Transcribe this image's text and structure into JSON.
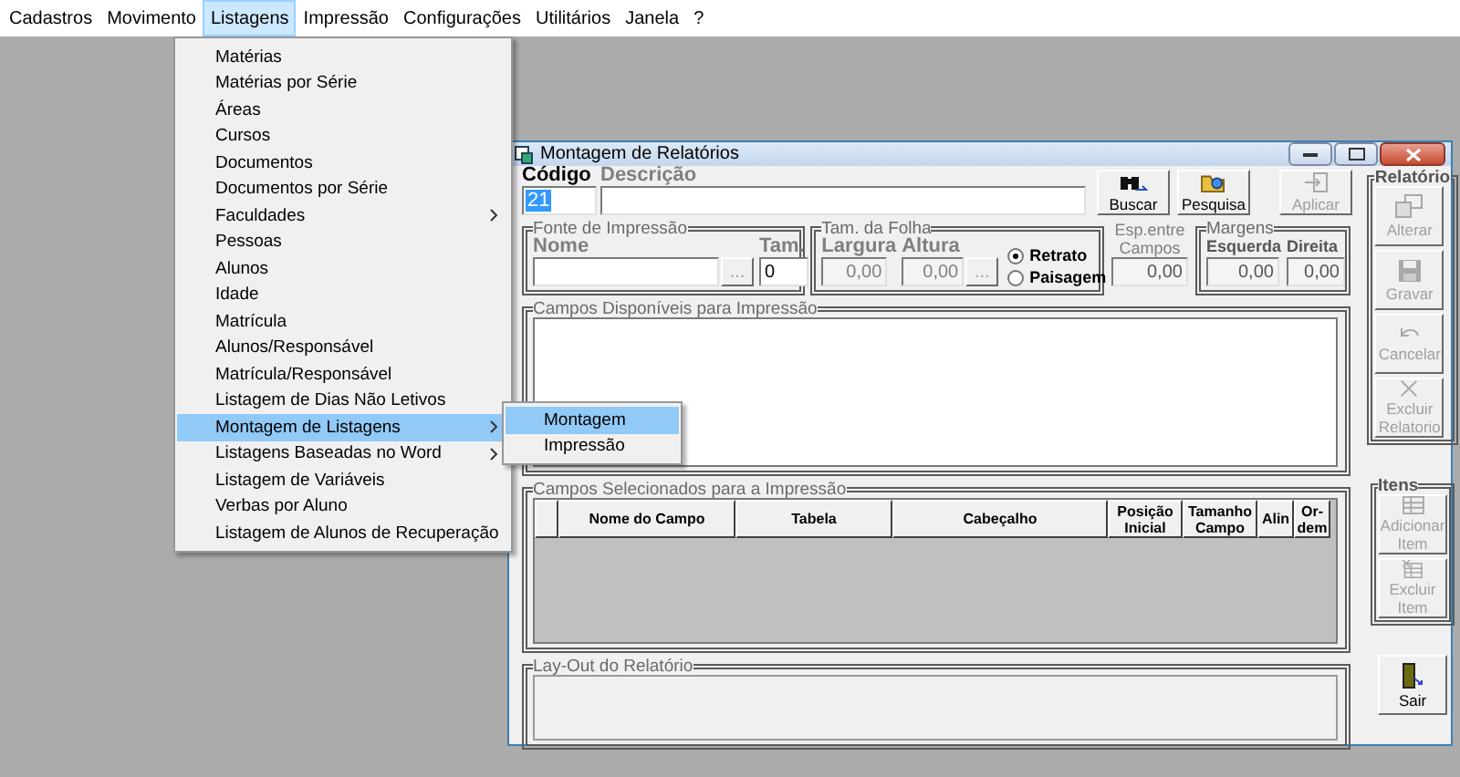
{
  "menu_bar": [
    {
      "label": "Cadastros",
      "selected": false
    },
    {
      "label": "Movimento",
      "selected": false
    },
    {
      "label": "Listagens",
      "selected": true
    },
    {
      "label": "Impressão",
      "selected": false
    },
    {
      "label": "Configurações",
      "selected": false
    },
    {
      "label": "Utilitários",
      "selected": false
    },
    {
      "label": "Janela",
      "selected": false
    },
    {
      "label": "?",
      "selected": false
    }
  ],
  "dropdown": [
    {
      "label": "Matérias",
      "selected": false,
      "submenu": false
    },
    {
      "label": "Matérias por Série",
      "selected": false,
      "submenu": false
    },
    {
      "label": "Áreas",
      "selected": false,
      "submenu": false
    },
    {
      "label": "Cursos",
      "selected": false,
      "submenu": false
    },
    {
      "label": "Documentos",
      "selected": false,
      "submenu": false
    },
    {
      "label": "Documentos por Série",
      "selected": false,
      "submenu": false
    },
    {
      "label": "Faculdades",
      "selected": false,
      "submenu": true
    },
    {
      "label": "Pessoas",
      "selected": false,
      "submenu": false
    },
    {
      "label": "Alunos",
      "selected": false,
      "submenu": false
    },
    {
      "label": "Idade",
      "selected": false,
      "submenu": false
    },
    {
      "label": "Matrícula",
      "selected": false,
      "submenu": false
    },
    {
      "label": "Alunos/Responsável",
      "selected": false,
      "submenu": false
    },
    {
      "label": "Matrícula/Responsável",
      "selected": false,
      "submenu": false
    },
    {
      "label": "Listagem de Dias Não Letivos",
      "selected": false,
      "submenu": false
    },
    {
      "label": "Montagem de Listagens",
      "selected": true,
      "submenu": true
    },
    {
      "label": "Listagens Baseadas no Word",
      "selected": false,
      "submenu": true
    },
    {
      "label": "Listagem de Variáveis",
      "selected": false,
      "submenu": false
    },
    {
      "label": "Verbas por Aluno",
      "selected": false,
      "submenu": false
    },
    {
      "label": "Listagem de Alunos de Recuperação",
      "selected": false,
      "submenu": false
    }
  ],
  "submenu": [
    {
      "label": "Montagem",
      "selected": true
    },
    {
      "label": "Impressão",
      "selected": false
    }
  ],
  "window": {
    "title": "Montagem de Relatórios",
    "codigo": {
      "label": "Código",
      "value": "21"
    },
    "descricao": {
      "label": "Descrição"
    },
    "top_buttons": [
      {
        "label": "Buscar",
        "kind": "binoculars",
        "disabled": false
      },
      {
        "label": "Pesquisa",
        "kind": "folder",
        "disabled": false
      },
      {
        "label": "Aplicar",
        "kind": "apply",
        "disabled": true
      }
    ],
    "fonte": {
      "title": "Fonte de Impressão",
      "nome_label": "Nome",
      "browse": "...",
      "tam_label": "Tam.",
      "tam_value": "0"
    },
    "folha": {
      "title": "Tam. da Folha",
      "largura_label": "Largura",
      "largura_value": "0,00",
      "altura_label": "Altura",
      "altura_value": "0,00",
      "browse": "...",
      "orientation": [
        {
          "label": "Retrato",
          "selected": true
        },
        {
          "label": "Paisagem",
          "selected": false
        }
      ]
    },
    "espaco": {
      "label": "Esp.entre Campos",
      "value": "0,00"
    },
    "margens": {
      "title": "Margens",
      "esquerda_label": "Esquerda",
      "esquerda_value": "0,00",
      "direita_label": "Direita",
      "direita_value": "0,00"
    },
    "disponiveis": {
      "title": "Campos Disponíveis para Impressão"
    },
    "selecionados": {
      "title": "Campos Selecionados para a Impressão",
      "columns": [
        "",
        "Nome do Campo",
        "Tabela",
        "Cabeçalho",
        "Posição Inicial",
        "Tamanho Campo",
        "Alin",
        "Or-dem"
      ]
    },
    "layout": {
      "title": "Lay-Out do Relatório"
    },
    "relatorio": {
      "title": "Relatório",
      "buttons": [
        {
          "label": "Alterar",
          "kind": "edit",
          "disabled": true
        },
        {
          "label": "Gravar",
          "kind": "save",
          "disabled": true
        },
        {
          "label": "Cancelar",
          "kind": "undo",
          "disabled": true
        },
        {
          "label": "Excluir Relatorio",
          "kind": "cross",
          "disabled": true
        }
      ]
    },
    "itens": {
      "title": "Itens",
      "buttons": [
        {
          "label": "Adicionar Item",
          "kind": "grid",
          "disabled": true
        },
        {
          "label": "Excluir Item",
          "kind": "grid-cross",
          "disabled": true
        }
      ]
    },
    "exit_button": {
      "label": "Sair",
      "kind": "door",
      "disabled": false
    }
  }
}
